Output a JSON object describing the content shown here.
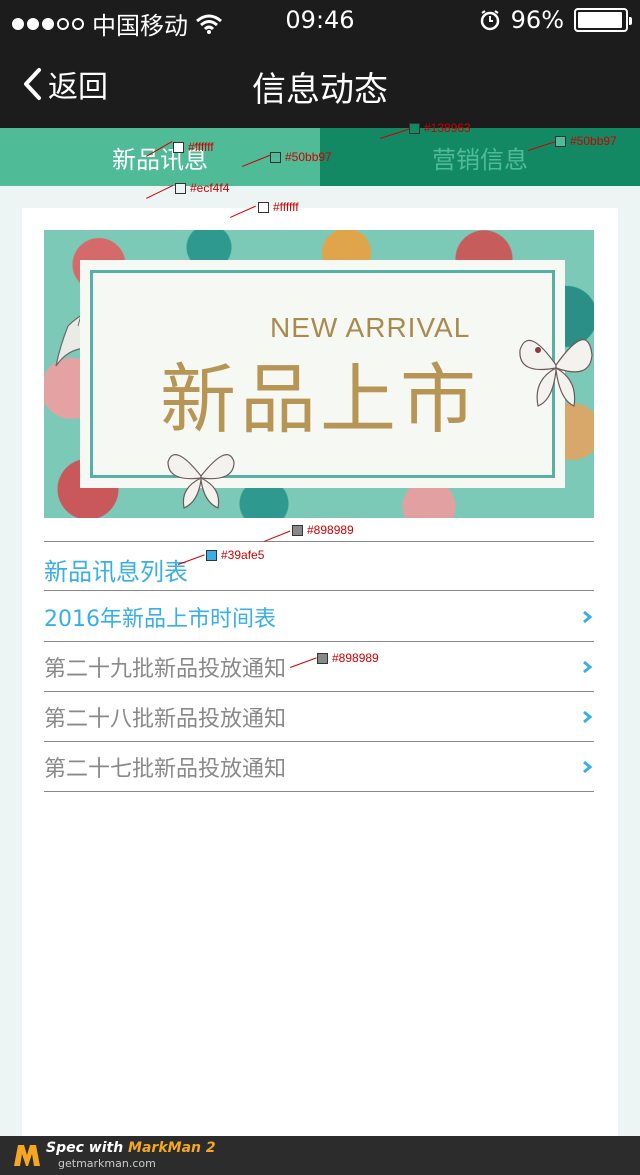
{
  "status_bar": {
    "carrier": "中国移动",
    "time": "09:46",
    "battery": "96%",
    "battery_level": 0.96,
    "signal_dots_filled": 3,
    "signal_dots_total": 5,
    "icons": [
      "signal-dots-icon",
      "wifi-icon",
      "alarm-icon",
      "battery-icon"
    ]
  },
  "nav": {
    "back_label": "返回",
    "title": "信息动态"
  },
  "tabs": [
    {
      "label": "新品讯息",
      "active": true
    },
    {
      "label": "营销信息",
      "active": false
    }
  ],
  "banner": {
    "en_text": "NEW ARRIVAL",
    "cn_text": "新品上市"
  },
  "list": {
    "header": "新品讯息列表",
    "items": [
      {
        "label": "2016年新品上市时间表",
        "highlight": true
      },
      {
        "label": "第二十九批新品投放通知",
        "highlight": false
      },
      {
        "label": "第二十八批新品投放通知",
        "highlight": false
      },
      {
        "label": "第二十七批新品投放通知",
        "highlight": false
      }
    ]
  },
  "annotations": {
    "tab_active_text": "#ffffff",
    "tab_inactive_bg": "#138963",
    "tab_active_bg": "#50bb97",
    "tab_inactive_text": "#50bb97",
    "page_bg": "#ecf4f4",
    "card_bg": "#ffffff",
    "divider": "#898989",
    "header_text": "#39afe5",
    "item_text": "#898989"
  },
  "footer": {
    "line1_prefix": "Spec with",
    "line1_brand": "MarkMan 2",
    "line2": "getmarkman.com"
  },
  "colors": {
    "accent": "#39afe5",
    "tab_active": "#50bb97",
    "tab_inactive": "#138963",
    "gray": "#898989",
    "bar_bg": "#1c1c1c"
  }
}
